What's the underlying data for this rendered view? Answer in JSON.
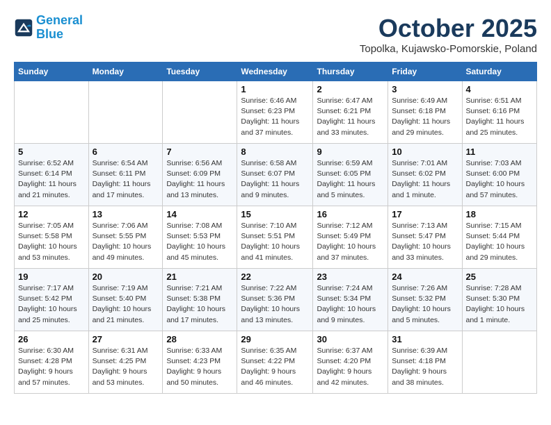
{
  "header": {
    "logo_line1": "General",
    "logo_line2": "Blue",
    "month": "October 2025",
    "location": "Topolka, Kujawsko-Pomorskie, Poland"
  },
  "days_of_week": [
    "Sunday",
    "Monday",
    "Tuesday",
    "Wednesday",
    "Thursday",
    "Friday",
    "Saturday"
  ],
  "weeks": [
    [
      {
        "day": "",
        "content": ""
      },
      {
        "day": "",
        "content": ""
      },
      {
        "day": "",
        "content": ""
      },
      {
        "day": "1",
        "content": "Sunrise: 6:46 AM\nSunset: 6:23 PM\nDaylight: 11 hours and 37 minutes."
      },
      {
        "day": "2",
        "content": "Sunrise: 6:47 AM\nSunset: 6:21 PM\nDaylight: 11 hours and 33 minutes."
      },
      {
        "day": "3",
        "content": "Sunrise: 6:49 AM\nSunset: 6:18 PM\nDaylight: 11 hours and 29 minutes."
      },
      {
        "day": "4",
        "content": "Sunrise: 6:51 AM\nSunset: 6:16 PM\nDaylight: 11 hours and 25 minutes."
      }
    ],
    [
      {
        "day": "5",
        "content": "Sunrise: 6:52 AM\nSunset: 6:14 PM\nDaylight: 11 hours and 21 minutes."
      },
      {
        "day": "6",
        "content": "Sunrise: 6:54 AM\nSunset: 6:11 PM\nDaylight: 11 hours and 17 minutes."
      },
      {
        "day": "7",
        "content": "Sunrise: 6:56 AM\nSunset: 6:09 PM\nDaylight: 11 hours and 13 minutes."
      },
      {
        "day": "8",
        "content": "Sunrise: 6:58 AM\nSunset: 6:07 PM\nDaylight: 11 hours and 9 minutes."
      },
      {
        "day": "9",
        "content": "Sunrise: 6:59 AM\nSunset: 6:05 PM\nDaylight: 11 hours and 5 minutes."
      },
      {
        "day": "10",
        "content": "Sunrise: 7:01 AM\nSunset: 6:02 PM\nDaylight: 11 hours and 1 minute."
      },
      {
        "day": "11",
        "content": "Sunrise: 7:03 AM\nSunset: 6:00 PM\nDaylight: 10 hours and 57 minutes."
      }
    ],
    [
      {
        "day": "12",
        "content": "Sunrise: 7:05 AM\nSunset: 5:58 PM\nDaylight: 10 hours and 53 minutes."
      },
      {
        "day": "13",
        "content": "Sunrise: 7:06 AM\nSunset: 5:55 PM\nDaylight: 10 hours and 49 minutes."
      },
      {
        "day": "14",
        "content": "Sunrise: 7:08 AM\nSunset: 5:53 PM\nDaylight: 10 hours and 45 minutes."
      },
      {
        "day": "15",
        "content": "Sunrise: 7:10 AM\nSunset: 5:51 PM\nDaylight: 10 hours and 41 minutes."
      },
      {
        "day": "16",
        "content": "Sunrise: 7:12 AM\nSunset: 5:49 PM\nDaylight: 10 hours and 37 minutes."
      },
      {
        "day": "17",
        "content": "Sunrise: 7:13 AM\nSunset: 5:47 PM\nDaylight: 10 hours and 33 minutes."
      },
      {
        "day": "18",
        "content": "Sunrise: 7:15 AM\nSunset: 5:44 PM\nDaylight: 10 hours and 29 minutes."
      }
    ],
    [
      {
        "day": "19",
        "content": "Sunrise: 7:17 AM\nSunset: 5:42 PM\nDaylight: 10 hours and 25 minutes."
      },
      {
        "day": "20",
        "content": "Sunrise: 7:19 AM\nSunset: 5:40 PM\nDaylight: 10 hours and 21 minutes."
      },
      {
        "day": "21",
        "content": "Sunrise: 7:21 AM\nSunset: 5:38 PM\nDaylight: 10 hours and 17 minutes."
      },
      {
        "day": "22",
        "content": "Sunrise: 7:22 AM\nSunset: 5:36 PM\nDaylight: 10 hours and 13 minutes."
      },
      {
        "day": "23",
        "content": "Sunrise: 7:24 AM\nSunset: 5:34 PM\nDaylight: 10 hours and 9 minutes."
      },
      {
        "day": "24",
        "content": "Sunrise: 7:26 AM\nSunset: 5:32 PM\nDaylight: 10 hours and 5 minutes."
      },
      {
        "day": "25",
        "content": "Sunrise: 7:28 AM\nSunset: 5:30 PM\nDaylight: 10 hours and 1 minute."
      }
    ],
    [
      {
        "day": "26",
        "content": "Sunrise: 6:30 AM\nSunset: 4:28 PM\nDaylight: 9 hours and 57 minutes."
      },
      {
        "day": "27",
        "content": "Sunrise: 6:31 AM\nSunset: 4:25 PM\nDaylight: 9 hours and 53 minutes."
      },
      {
        "day": "28",
        "content": "Sunrise: 6:33 AM\nSunset: 4:23 PM\nDaylight: 9 hours and 50 minutes."
      },
      {
        "day": "29",
        "content": "Sunrise: 6:35 AM\nSunset: 4:22 PM\nDaylight: 9 hours and 46 minutes."
      },
      {
        "day": "30",
        "content": "Sunrise: 6:37 AM\nSunset: 4:20 PM\nDaylight: 9 hours and 42 minutes."
      },
      {
        "day": "31",
        "content": "Sunrise: 6:39 AM\nSunset: 4:18 PM\nDaylight: 9 hours and 38 minutes."
      },
      {
        "day": "",
        "content": ""
      }
    ]
  ]
}
